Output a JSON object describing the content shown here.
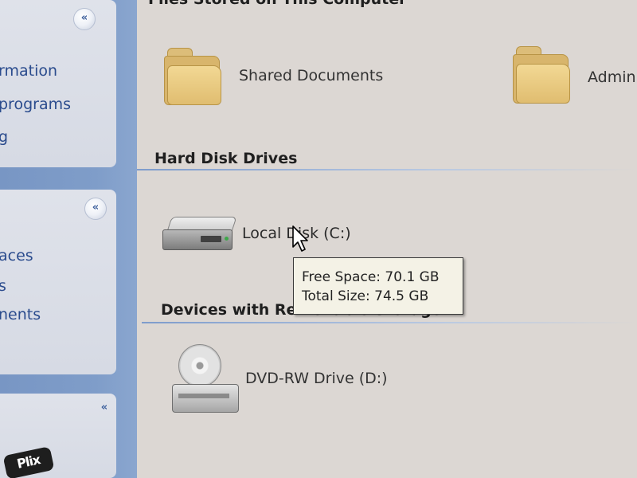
{
  "taskpane": {
    "panel1": {
      "links": [
        "rmation",
        "programs",
        "g"
      ]
    },
    "panel2": {
      "links": [
        "aces",
        "s",
        "nents"
      ]
    },
    "collapse_glyph": "«"
  },
  "content": {
    "top_group_title": "Files Stored on This Computer",
    "folders": [
      {
        "label": "Shared Documents"
      },
      {
        "label": "Admini"
      }
    ],
    "hard_disk_section": "Hard Disk Drives",
    "local_disk": "Local Disk (C:)",
    "removable_section": "Devices with Removable Storage",
    "dvd_drive": "DVD-RW Drive (D:)"
  },
  "tooltip": {
    "free_space": "Free Space: 70.1 GB",
    "total_size": "Total Size: 74.5 GB"
  },
  "watermark": {
    "text": "Plix"
  }
}
